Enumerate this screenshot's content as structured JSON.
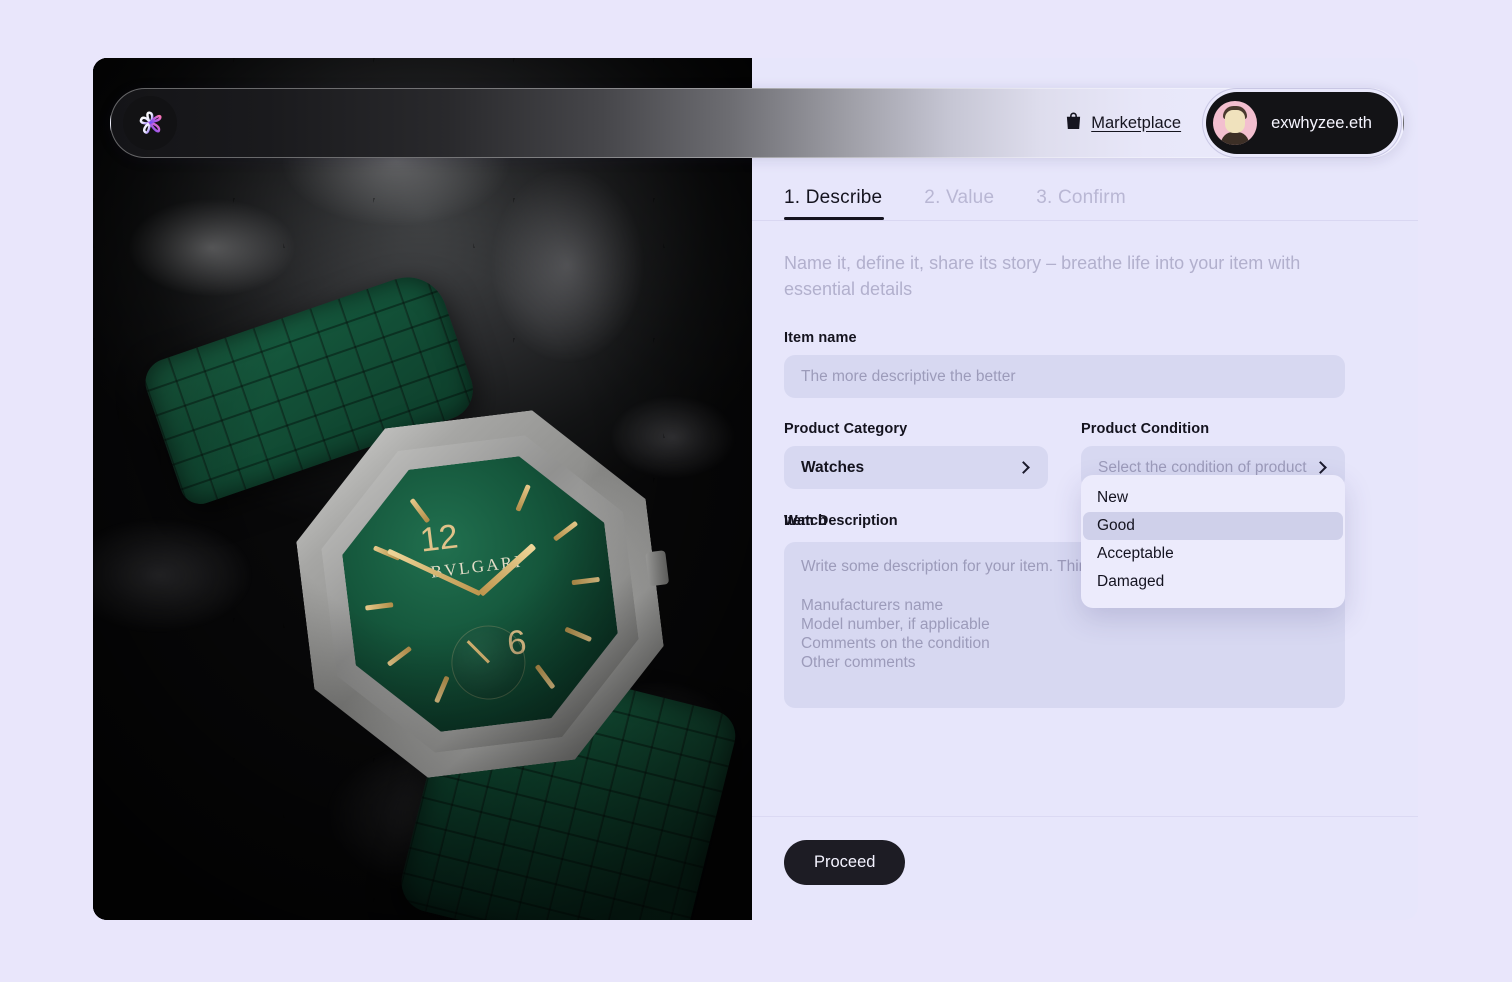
{
  "header": {
    "logo_name": "pinwheel-logo",
    "marketplace_label": "Marketplace",
    "bag_icon": "shopping-bag-icon",
    "user": {
      "name": "exwhyzee.eth",
      "avatar": "user-avatar"
    }
  },
  "tabs": [
    {
      "label": "1. Describe",
      "active": true
    },
    {
      "label": "2. Value",
      "active": false
    },
    {
      "label": "3. Confirm",
      "active": false
    }
  ],
  "form": {
    "intro": "Name it, define it, share its story – breathe life into your item with essential details",
    "item_name": {
      "label": "Item name",
      "placeholder": "The more descriptive the better",
      "value": ""
    },
    "product_category": {
      "label": "Product Category",
      "value": "Watches",
      "chevron": "chevron-right-icon"
    },
    "product_condition": {
      "label": "Product Condition",
      "placeholder": "Select the condition of product",
      "value": "",
      "chevron": "chevron-right-icon",
      "options": [
        "New",
        "Good",
        "Acceptable",
        "Damaged"
      ],
      "highlighted": "Good",
      "open": true
    },
    "description": {
      "label": "Item Description",
      "overlay_label": "Watch",
      "placeholder_intro": "Write some description for your item. Thin",
      "placeholder_lines": [
        "Manufacturers name",
        "Model number, if applicable",
        "Comments on the condition",
        "Other comments"
      ]
    }
  },
  "footer": {
    "proceed_label": "Proceed"
  },
  "colors": {
    "page_bg": "#e9e6fb",
    "panel_bg": "#e7e6fb",
    "field_bg": "#d7d8f1",
    "menu_bg": "#ecebfc",
    "menu_selected": "#cfd0ea",
    "text_dark": "#14131e",
    "text_muted": "#b2b0cd",
    "button_dark": "#1d1c24"
  }
}
